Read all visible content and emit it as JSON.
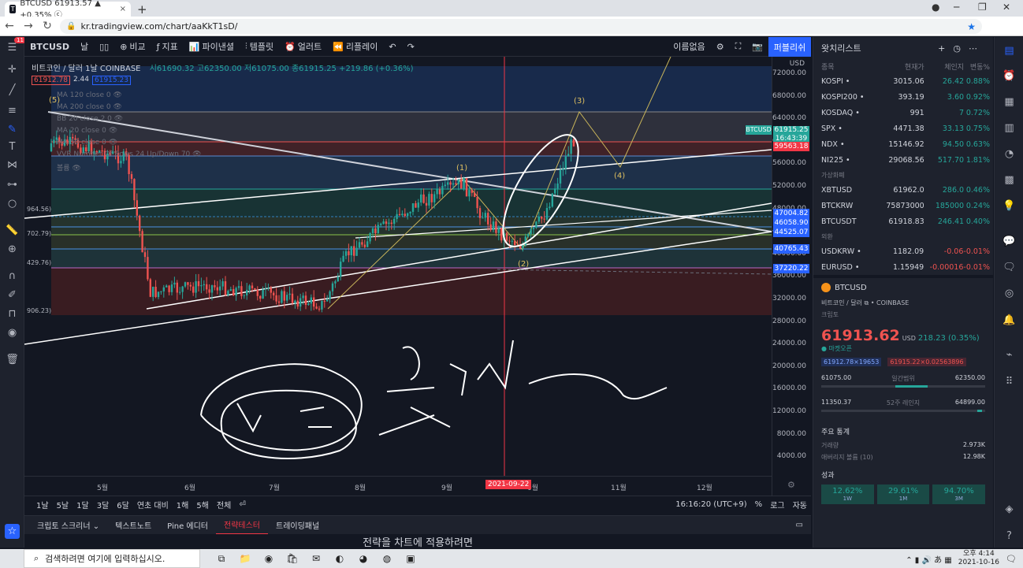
{
  "browser": {
    "tab_title": "BTCUSD 61913.57 ▲ +0.35% ⓒ",
    "tab_close": "×",
    "new_tab": "+",
    "url": "kr.tradingview.com/chart/aaKkT1sD/",
    "win_min": "─",
    "win_max": "❐",
    "win_close": "✕"
  },
  "toolbar": {
    "menu_badge": "11",
    "symbol": "BTCUSD",
    "interval": "날",
    "compare": "비교",
    "indicators": "지표",
    "financials": "파이낸셜",
    "templates": "템플릿",
    "alert": "얼러트",
    "replay": "리플레이",
    "layout_name": "이름없음",
    "publish": "퍼블리쉬"
  },
  "legend": {
    "title": "비트코인 / 달러  1날  COINBASE",
    "ohlc": "시61690.32 고62350.00 저61075.00 종61915.25 +219.86 (+0.36%)",
    "bid": "61912.78",
    "spread": "2.44",
    "ask": "61915.23"
  },
  "indicators": [
    "MA 120 close 0",
    "MA 200 close 0",
    "BB 20 close 2 0",
    "MA 20 close 0",
    "MA 50 close 0",
    "VVR Number Of Rows 24 Up/Down 70",
    "볼륨"
  ],
  "chart_labels": {
    "w1": "(1)",
    "w2": "(2)",
    "w3": "(3)",
    "w4": "(4)",
    "w5": "(5)",
    "fib_964": "964.56)",
    "fib_702": "702.79)",
    "fib_429": "429.76)",
    "fib_906": "906.23)"
  },
  "price_axis": {
    "currency": "USD",
    "ticks": [
      "72000.00",
      "68000.00",
      "64000.00",
      "60000.00",
      "56000.00",
      "52000.00",
      "48000.00",
      "44000.00",
      "40000.00",
      "36000.00",
      "32000.00",
      "28000.00",
      "24000.00",
      "20000.00",
      "16000.00",
      "12000.00",
      "8000.00",
      "4000.00"
    ],
    "btc_tag": "BTCUSD",
    "btc_price": "61915.25",
    "btc_time": "16:43:39",
    "tags": [
      "59563.18",
      "47004.82",
      "46058.90",
      "44525.07",
      "40765.43",
      "37220.22"
    ]
  },
  "time_axis": {
    "labels": [
      "5월",
      "6월",
      "7월",
      "8월",
      "9월",
      "0월",
      "11월",
      "12월"
    ],
    "cursor_date": "2021-09-22"
  },
  "range_bar": {
    "items": [
      "1날",
      "5날",
      "1달",
      "3달",
      "6달",
      "연초 대비",
      "1해",
      "5해",
      "전체"
    ],
    "time": "16:16:20 (UTC+9)",
    "percent": "%",
    "log": "로그",
    "auto": "자동"
  },
  "bottom_tabs": [
    "크립토 스크리너",
    "텍스트노트",
    "Pine 에디터",
    "전략테스터",
    "트레이딩패널"
  ],
  "strategy_msg": "전략을 차트에 적용하려면",
  "watchlist": {
    "title": "왓치리스트",
    "cols": [
      "종목",
      "현재가",
      "체인지",
      "변동%"
    ],
    "rows1": [
      {
        "s": "KOSPI",
        "p": "3015.06",
        "c": "26.42",
        "pc": "0.88%"
      },
      {
        "s": "KOSPI200",
        "p": "393.19",
        "c": "3.60",
        "pc": "0.92%"
      },
      {
        "s": "KOSDAQ",
        "p": "991",
        "c": "7",
        "pc": "0.72%"
      },
      {
        "s": "SPX",
        "p": "4471.38",
        "c": "33.13",
        "pc": "0.75%"
      },
      {
        "s": "NDX",
        "p": "15146.92",
        "c": "94.50",
        "pc": "0.63%"
      },
      {
        "s": "NI225",
        "p": "29068.56",
        "c": "517.70",
        "pc": "1.81%"
      }
    ],
    "sec_crypto": "가상화폐",
    "rows2": [
      {
        "s": "XBTUSD",
        "p": "61962.0",
        "c": "286.0",
        "pc": "0.46%"
      },
      {
        "s": "BTCKRW",
        "p": "75873000",
        "c": "185000",
        "pc": "0.24%"
      },
      {
        "s": "BTCUSDT",
        "p": "61918.83",
        "c": "246.41",
        "pc": "0.40%"
      }
    ],
    "sec_fx": "외환",
    "rows3": [
      {
        "s": "USDKRW",
        "p": "1182.09",
        "c": "-0.06",
        "pc": "-0.01%"
      },
      {
        "s": "EURUSD",
        "p": "1.15949",
        "c": "-0.00016",
        "pc": "-0.01%"
      }
    ]
  },
  "details": {
    "symbol": "BTCUSD",
    "name": "비트코인 / 달러 ⧉ • COINBASE",
    "category": "크립토",
    "price": "61913.62",
    "currency": "USD",
    "change": "218.23 (0.35%)",
    "status": "● 마켓오픈",
    "bid": "61912.78×19653",
    "ask": "61915.22×0.02563896",
    "day_low": "61075.00",
    "day_label": "일간범위",
    "day_high": "62350.00",
    "wk_low": "11350.37",
    "wk_label": "52주 레인지",
    "wk_high": "64899.00",
    "stats_title": "주요 통계",
    "vol_label": "거래량",
    "vol": "2.973K",
    "avgvol_label": "애버리지 볼륨 (10)",
    "avgvol": "12.98K",
    "perf_title": "성과",
    "perf": [
      {
        "v": "12.62%",
        "l": "1W"
      },
      {
        "v": "29.61%",
        "l": "1M"
      },
      {
        "v": "94.70%",
        "l": "3M"
      }
    ]
  },
  "taskbar": {
    "search": "검색하려면 여기에 입력하십시오.",
    "time": "오후 4:14",
    "date": "2021-10-16"
  },
  "handwriting": "손글씨 주석"
}
